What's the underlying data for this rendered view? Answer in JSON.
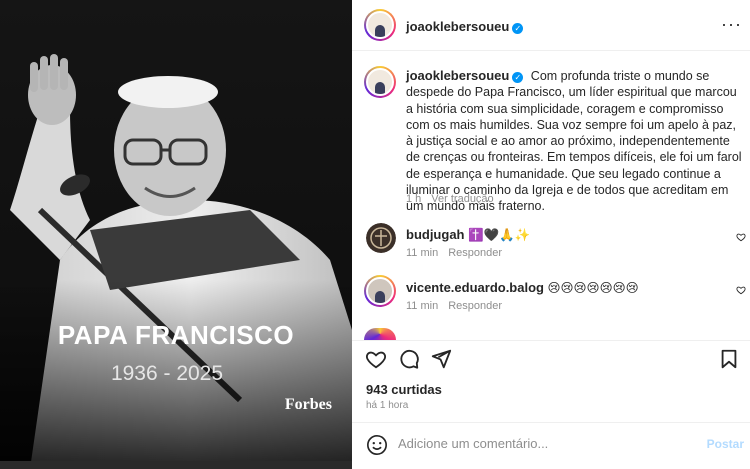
{
  "image": {
    "headline": "PAPA FRANCISCO",
    "years": "1936 - 2025",
    "brand": "Forbes"
  },
  "post": {
    "author": "joaoklebersoueu",
    "more_label": "···",
    "caption": "Com profunda triste o mundo se despede do Papa Francisco, um líder espiritual que marcou a história com sua simplicidade, coragem e compromisso com os mais humildes. Sua voz sempre foi um apelo à paz, à justiça social e ao amor ao próximo, independentemente de crenças ou fronteiras. Em tempos difíceis, ele foi um farol de esperança e humanidade. Que seu legado continue a iluminar o caminho da Igreja e de todos que acreditam em um mundo mais fraterno.",
    "caption_time": "1 h",
    "translate_label": "Ver tradução"
  },
  "comments": [
    {
      "user": "budjugah",
      "text": "✝️🖤🙏✨",
      "time": "11 min",
      "reply": "Responder"
    },
    {
      "user": "vicente.eduardo.balog",
      "text": "😢😢😢😢😢😢😢",
      "time": "11 min",
      "reply": "Responder"
    }
  ],
  "likes": "943 curtidas",
  "posted": "há 1 hora",
  "comment_box": {
    "placeholder": "Adicione um comentário...",
    "post_label": "Postar"
  },
  "colors": {
    "verified": "#0095f6",
    "post_disabled": "#b3dbff",
    "secondary_text": "#8e8e8e"
  }
}
